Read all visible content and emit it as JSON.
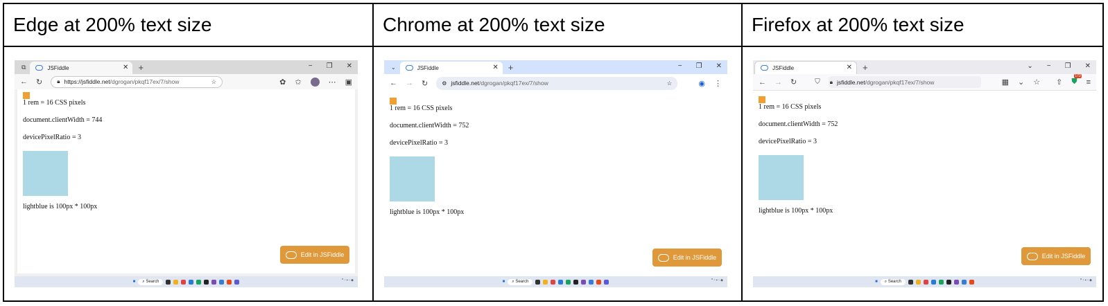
{
  "panels": [
    {
      "heading": "Edge at 200% text size",
      "tab_title": "JSFiddle",
      "url_domain": "https://jsfiddle.net",
      "url_path": "/dgrogan/pkqf17ex/7/show",
      "rem_text": "1 rem = 16 CSS pixels",
      "client_width_text": "document.clientWidth = 744",
      "dpr_text": "devicePixelRatio = 3",
      "box_text": "lightblue is 100px * 100px",
      "edit_button": "Edit in JSFiddle",
      "taskbar_search": "Search"
    },
    {
      "heading": "Chrome at 200% text size",
      "tab_title": "JSFiddle",
      "url_domain": "jsfiddle.net",
      "url_path": "/dgrogan/pkqf17ex/7/show",
      "rem_text": "1 rem = 16 CSS pixels",
      "client_width_text": "document.clientWidth = 752",
      "dpr_text": "devicePixelRatio = 3",
      "box_text": "lightblue is 100px * 100px",
      "edit_button": "Edit in JSFiddle",
      "taskbar_search": "Search"
    },
    {
      "heading": "Firefox at 200% text size",
      "tab_title": "JSFiddle",
      "url_domain": "jsfiddle.net",
      "url_path": "/dgrogan/pkqf17ex/7/show",
      "rem_text": "1 rem = 16 CSS pixels",
      "client_width_text": "document.clientWidth = 752",
      "dpr_text": "devicePixelRatio = 3",
      "box_text": "lightblue is 100px * 100px",
      "edit_button": "Edit in JSFiddle",
      "taskbar_search": "Search",
      "badge_count": "173"
    }
  ],
  "icons": {
    "back": "←",
    "forward": "→",
    "reload": "↻",
    "close": "✕",
    "new_tab": "+",
    "minimize": "−",
    "restore": "❐",
    "star": "☆",
    "menu": "⋯"
  },
  "colors": {
    "orange_square": "#f0a030",
    "lightblue_box": "#add8e6",
    "edit_button": "#e0993a"
  }
}
